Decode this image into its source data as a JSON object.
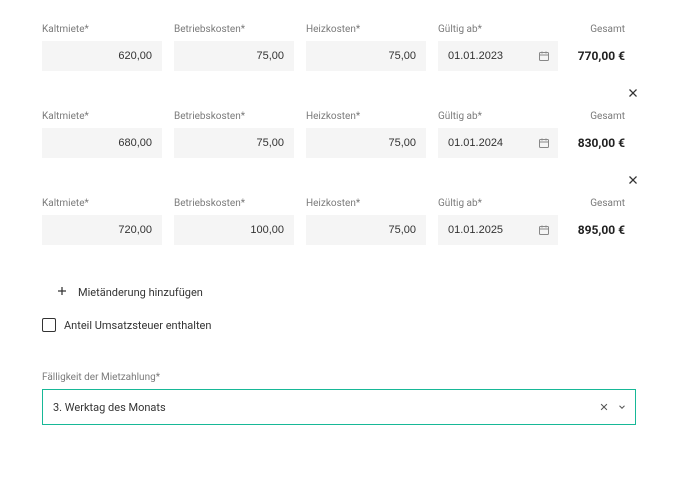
{
  "labels": {
    "kaltmiete": "Kaltmiete*",
    "betriebskosten": "Betriebskosten*",
    "heizkosten": "Heizkosten*",
    "gueltig_ab": "Gültig ab*",
    "gesamt": "Gesamt"
  },
  "currency": "€",
  "rents": [
    {
      "kaltmiete": "620,00",
      "betriebskosten": "75,00",
      "heizkosten": "75,00",
      "gueltig_ab": "01.01.2023",
      "gesamt": "770,00",
      "closable": false
    },
    {
      "kaltmiete": "680,00",
      "betriebskosten": "75,00",
      "heizkosten": "75,00",
      "gueltig_ab": "01.01.2024",
      "gesamt": "830,00",
      "closable": true
    },
    {
      "kaltmiete": "720,00",
      "betriebskosten": "100,00",
      "heizkosten": "75,00",
      "gueltig_ab": "01.01.2025",
      "gesamt": "895,00",
      "closable": true
    }
  ],
  "add_label": "Mietänderung hinzufügen",
  "vat_label": "Anteil Umsatzsteuer enthalten",
  "due": {
    "label": "Fälligkeit der Mietzahlung*",
    "value": "3. Werktag des Monats"
  }
}
